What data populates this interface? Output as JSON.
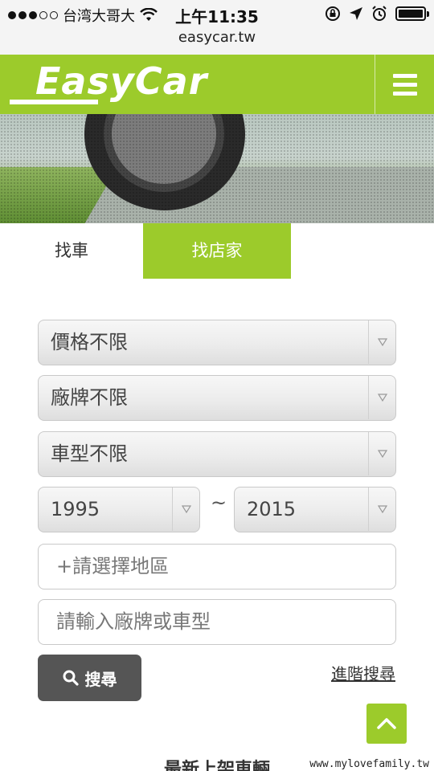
{
  "status_bar": {
    "carrier": "台湾大哥大",
    "time": "上午11:35"
  },
  "url_bar": {
    "url": "easycar.tw"
  },
  "header": {
    "logo_text": "EasyCar",
    "brand_color": "#9ccb2b",
    "menu_icon": "hamburger-icon"
  },
  "tabs": [
    {
      "label": "找車"
    },
    {
      "label": "找店家"
    }
  ],
  "form": {
    "price": "價格不限",
    "brand": "廠牌不限",
    "model": "車型不限",
    "year_from": "1995",
    "year_separator": "~",
    "year_to": "2015",
    "region": "+請選擇地區",
    "keyword_placeholder": "請輸入廠牌或車型",
    "search_label": "搜尋",
    "advanced_label": "進階搜尋"
  },
  "section": {
    "title": "最新上架車輛"
  },
  "watermark": "www.mylovefamily.tw"
}
